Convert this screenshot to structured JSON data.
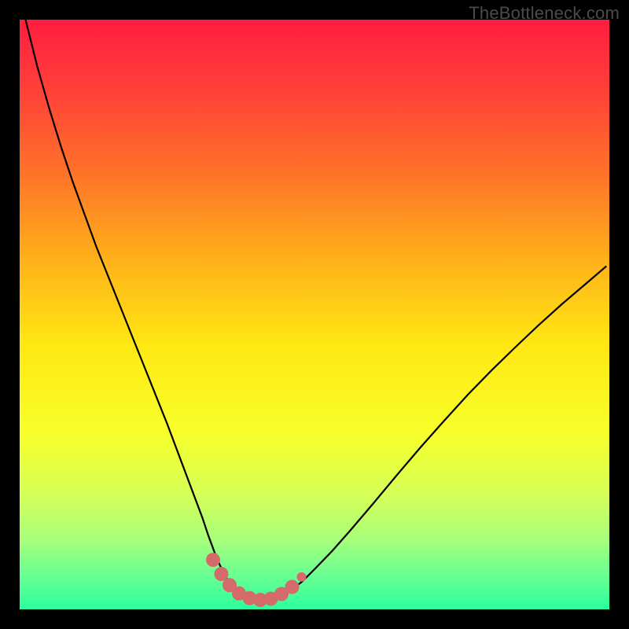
{
  "watermark": "TheBottleneck.com",
  "chart_data": {
    "type": "line",
    "title": "",
    "xlabel": "",
    "ylabel": "",
    "xlim": [
      0,
      100
    ],
    "ylim": [
      0,
      100
    ],
    "grid": false,
    "legend": false,
    "annotations": [],
    "background_gradient": {
      "stops": [
        {
          "offset": 0.0,
          "color": "#ff1d3f"
        },
        {
          "offset": 0.1,
          "color": "#ff3a3a"
        },
        {
          "offset": 0.25,
          "color": "#ff6e2a"
        },
        {
          "offset": 0.4,
          "color": "#ffae1a"
        },
        {
          "offset": 0.55,
          "color": "#ffe713"
        },
        {
          "offset": 0.7,
          "color": "#f7ff2a"
        },
        {
          "offset": 0.8,
          "color": "#d8ff55"
        },
        {
          "offset": 0.88,
          "color": "#a8ff7a"
        },
        {
          "offset": 0.94,
          "color": "#6cff92"
        },
        {
          "offset": 1.0,
          "color": "#2bff9d"
        }
      ]
    },
    "series": [
      {
        "name": "bottleneck-curve",
        "color": "#000000",
        "stroke_width": 2.2,
        "x": [
          1.0,
          3,
          5,
          7,
          9,
          11,
          13,
          15,
          17,
          19,
          21,
          23,
          25,
          26.5,
          28,
          29.5,
          31,
          32,
          33,
          34,
          35,
          36,
          37,
          38,
          39.5,
          41,
          42.5,
          44,
          46,
          48,
          50,
          53,
          56,
          60,
          64,
          68,
          72,
          76,
          80,
          84,
          88,
          92,
          96,
          99.5
        ],
        "y": [
          100,
          92,
          85,
          78.5,
          72.5,
          67,
          61.5,
          56.5,
          51.5,
          46.5,
          41.5,
          36.5,
          31.5,
          27.5,
          23.5,
          19.5,
          15.5,
          12.5,
          9.8,
          7.4,
          5.4,
          3.9,
          2.8,
          2.1,
          1.6,
          1.4,
          1.5,
          2.0,
          3.2,
          4.8,
          6.8,
          9.9,
          13.3,
          18.0,
          22.8,
          27.5,
          32.0,
          36.4,
          40.5,
          44.4,
          48.2,
          51.8,
          55.2,
          58.2
        ]
      }
    ],
    "highlight_points": {
      "name": "near-minimum-markers",
      "color": "#d46a6a",
      "radius_large": 9,
      "radius_small": 6,
      "points": [
        {
          "x": 32.8,
          "y": 8.4,
          "r": "large"
        },
        {
          "x": 34.2,
          "y": 6.0,
          "r": "large"
        },
        {
          "x": 35.6,
          "y": 4.1,
          "r": "large"
        },
        {
          "x": 37.2,
          "y": 2.7,
          "r": "large"
        },
        {
          "x": 39.0,
          "y": 1.9,
          "r": "large"
        },
        {
          "x": 40.8,
          "y": 1.6,
          "r": "large"
        },
        {
          "x": 42.6,
          "y": 1.8,
          "r": "large"
        },
        {
          "x": 44.4,
          "y": 2.6,
          "r": "large"
        },
        {
          "x": 46.2,
          "y": 3.8,
          "r": "large"
        },
        {
          "x": 47.8,
          "y": 5.5,
          "r": "small"
        }
      ]
    }
  }
}
